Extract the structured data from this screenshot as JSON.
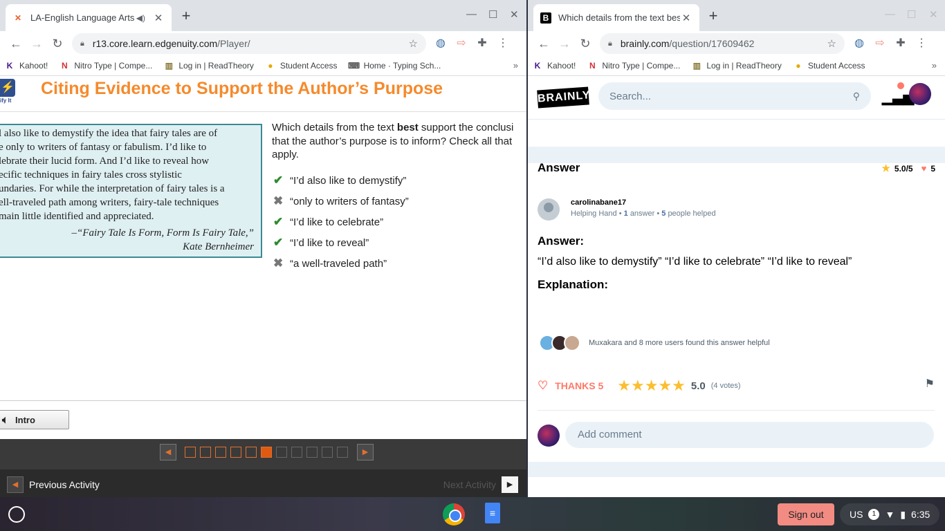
{
  "left_browser": {
    "tab_title": "LA-English Language Arts 1(",
    "url_host": "r13.core.learn.edgenuity.com",
    "url_path": "/Player/",
    "bookmarks": [
      "Kahoot!",
      "Nitro Type | Compe...",
      "Log in | ReadTheory",
      "Student Access",
      "Home · Typing Sch..."
    ]
  },
  "right_browser": {
    "tab_title": "Which details from the text best",
    "url_host": "brainly.com",
    "url_path": "/question/17609462",
    "bookmarks": [
      "Kahoot!",
      "Nitro Type | Compe...",
      "Log in | ReadTheory",
      "Student Access"
    ]
  },
  "edgenuity": {
    "logo_text": "ify It",
    "title": "Citing Evidence to Support the Author’s Purpose",
    "passage": "l also like to demystify the idea that fairy tales are of\ne only to writers of fantasy or fabulism. I’d like to\nlebrate their lucid form. And I’d like to reveal how\necific techniques in fairy tales cross stylistic\nundaries. For while the interpretation of fairy tales is a\nell-traveled path among writers, fairy-tale techniques\nmain little identified and appreciated.",
    "citation_line1": "–“Fairy Tale Is Form, Form Is Fairy Tale,”",
    "citation_line2": "Kate Bernheimer",
    "question_pre": "Which details from the text ",
    "question_bold": "best",
    "question_line1_post": " support the conclusi",
    "question_line2": "that the author’s purpose is to inform? Check all that",
    "question_line3": "apply.",
    "options": [
      {
        "text": "“I’d also like to demystify”",
        "state": "check"
      },
      {
        "text": "“only to writers of fantasy”",
        "state": "cross"
      },
      {
        "text": "“I’d like to celebrate”",
        "state": "check"
      },
      {
        "text": "“I’d like to reveal”",
        "state": "check"
      },
      {
        "text": "“a well-traveled path”",
        "state": "cross"
      }
    ],
    "intro_label": "Intro",
    "progress": {
      "total": 11,
      "completed": 5,
      "current": 6
    },
    "prev_label": "Previous Activity",
    "next_label": "Next Activity"
  },
  "brainly": {
    "logo": "BRAINLY",
    "search_placeholder": "Search...",
    "answer_heading": "Answer",
    "rating": "5.0/5",
    "thanks_count": "5",
    "user_name": "carolinabane17",
    "user_rank": "Helping Hand",
    "user_answers": "1",
    "user_answers_label": "answer",
    "user_helped": "5",
    "user_helped_label": "people helped",
    "answer_label": "Answer:",
    "answer_text": "“I’d also like to demystify”  “I’d like to celebrate”  “I’d like to reveal”",
    "explanation_label": "Explanation:",
    "helpful_text": "Muxakara and 8 more users found this answer helpful",
    "thanks_label": "THANKS 5",
    "stars": 5,
    "score": "5.0",
    "votes": "(4 votes)",
    "comment_placeholder": "Add comment"
  },
  "taskbar": {
    "sign_out": "Sign out",
    "locale": "US",
    "notifications": "1",
    "time": "6:35"
  }
}
